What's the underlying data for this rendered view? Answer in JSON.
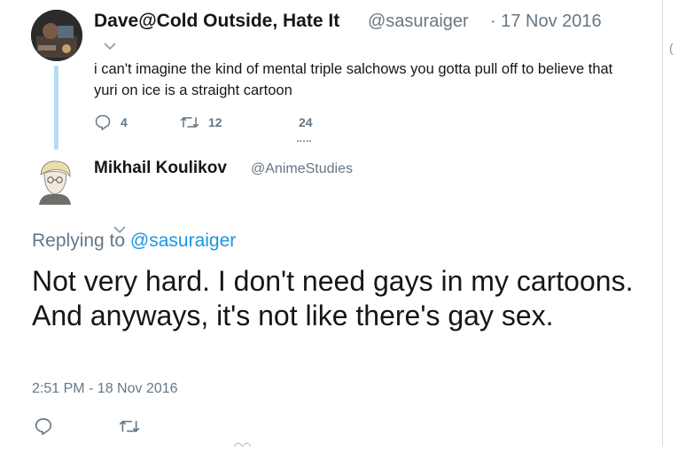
{
  "parent_tweet": {
    "display_name": "Dave@Cold Outside, Hate It",
    "handle": "@sasuraiger",
    "date": "· 17 Nov 2016",
    "text": "i can't imagine the kind of mental triple salchows you gotta pull off to believe that yuri on ice is a straight cartoon",
    "replies": "4",
    "retweets": "12",
    "likes": "24"
  },
  "reply_tweet": {
    "display_name": "Mikhail Koulikov",
    "handle": "@AnimeStudies",
    "replying_prefix": "Replying to",
    "replying_to": "@sasuraiger",
    "text": "Not very hard. I don't need gays in my cartoons. And anyways, it's not like there's gay sex.",
    "timestamp": "2:51 PM - 18 Nov 2016"
  },
  "colors": {
    "text": "#14171a",
    "secondary": "#657786",
    "link": "#1b95e0",
    "thread_line": "#b4ddf5"
  },
  "icons": {
    "reply": "reply-icon",
    "retweet": "retweet-icon",
    "like": "like-icon",
    "caret": "chevron-down-icon"
  }
}
